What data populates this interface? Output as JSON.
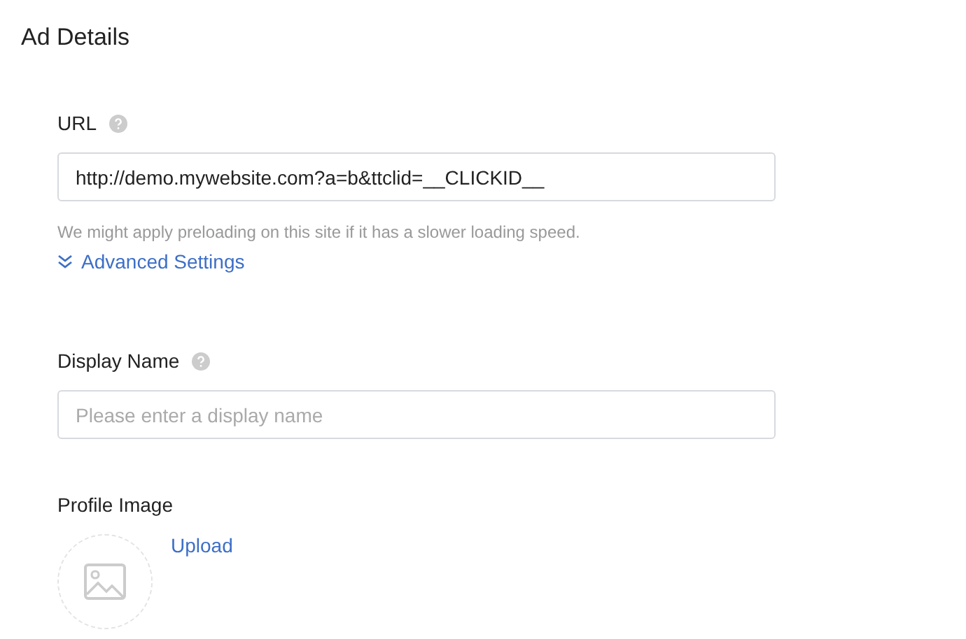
{
  "title": "Ad Details",
  "url_field": {
    "label": "URL",
    "value": "http://demo.mywebsite.com?a=b&ttclid=__CLICKID__",
    "hint": "We might apply preloading on this site if it has a slower loading speed.",
    "advanced_link": "Advanced Settings"
  },
  "display_name_field": {
    "label": "Display Name",
    "placeholder": "Please enter a display name"
  },
  "profile_image": {
    "label": "Profile Image",
    "upload_link": "Upload"
  }
}
